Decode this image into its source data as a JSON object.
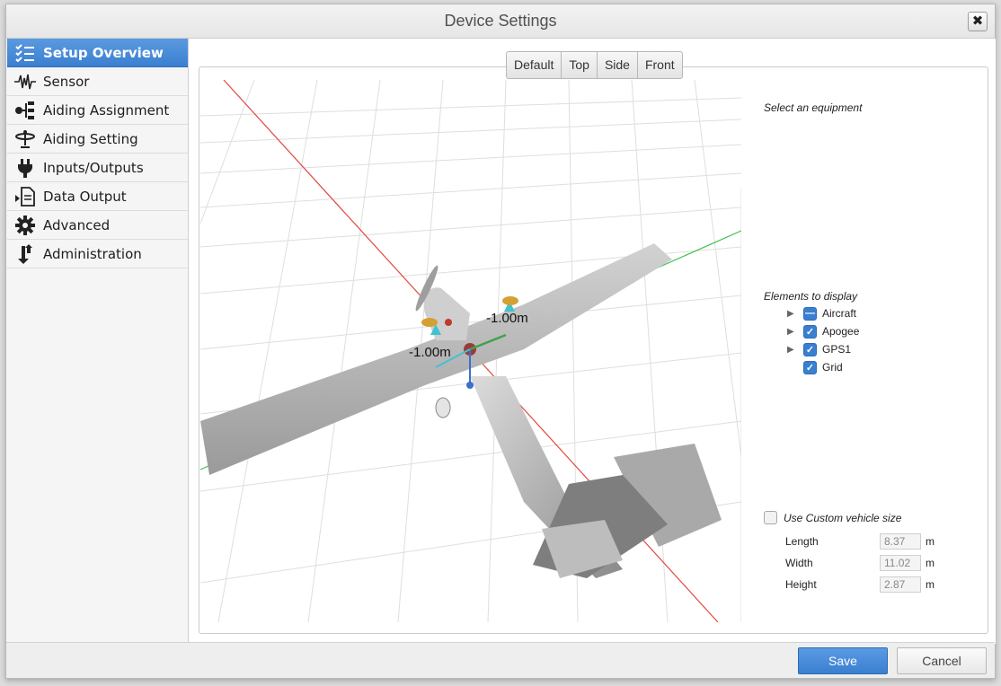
{
  "window": {
    "title": "Device Settings",
    "close_symbol": "✖"
  },
  "sidebar": {
    "items": [
      {
        "label": "Setup Overview",
        "icon": "checklist-icon",
        "active": true
      },
      {
        "label": "Sensor",
        "icon": "waveform-icon"
      },
      {
        "label": "Aiding Assignment",
        "icon": "hierarchy-icon"
      },
      {
        "label": "Aiding Setting",
        "icon": "antenna-icon"
      },
      {
        "label": "Inputs/Outputs",
        "icon": "plug-icon"
      },
      {
        "label": "Data Output",
        "icon": "document-export-icon"
      },
      {
        "label": "Advanced",
        "icon": "gear-icon"
      },
      {
        "label": "Administration",
        "icon": "transfer-arrows-icon"
      }
    ]
  },
  "view_tabs": [
    "Default",
    "Top",
    "Side",
    "Front"
  ],
  "scene": {
    "labels": [
      "-1.00m",
      "-1.00m"
    ],
    "colors": {
      "x_axis": "#e0493f",
      "y_axis": "#3fbf4f",
      "grid": "#dcdcdc",
      "aircraft": "#b8b8b8"
    }
  },
  "equipment": {
    "label": "Select an equipment"
  },
  "elements": {
    "label": "Elements to display",
    "items": [
      {
        "label": "Aircraft",
        "expandable": true,
        "state": "partial"
      },
      {
        "label": "Apogee",
        "expandable": true,
        "state": "checked"
      },
      {
        "label": "GPS1",
        "expandable": true,
        "state": "checked"
      },
      {
        "label": "Grid",
        "expandable": false,
        "state": "checked"
      }
    ]
  },
  "custom_size": {
    "label": "Use Custom vehicle size",
    "checked": false,
    "fields": [
      {
        "label": "Length",
        "value": "8.37",
        "unit": "m"
      },
      {
        "label": "Width",
        "value": "11.02",
        "unit": "m"
      },
      {
        "label": "Height",
        "value": "2.87",
        "unit": "m"
      }
    ]
  },
  "footer": {
    "save_label": "Save",
    "cancel_label": "Cancel"
  }
}
